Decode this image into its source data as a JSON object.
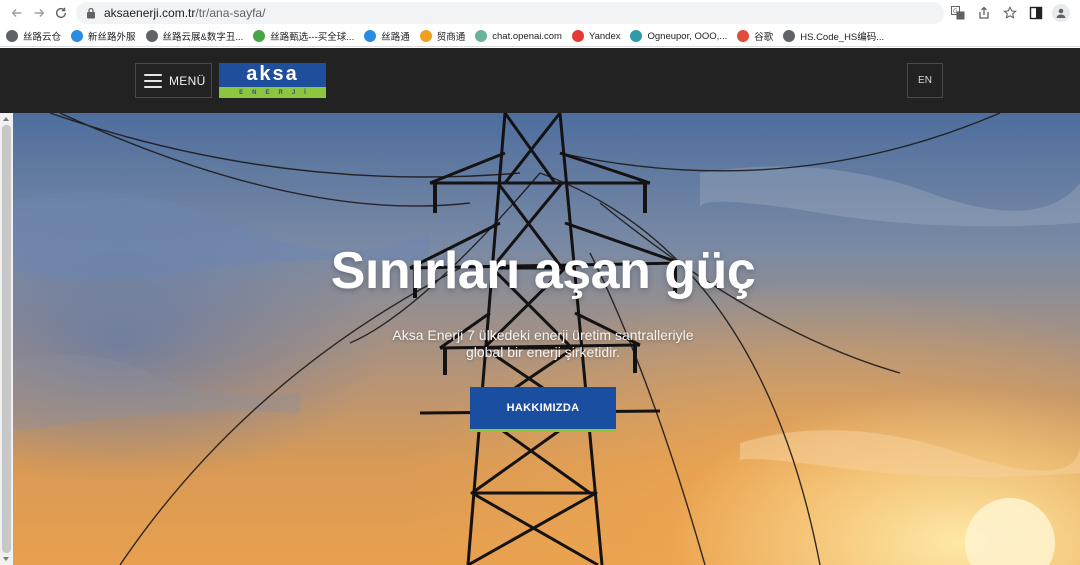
{
  "browser": {
    "url_host": "aksaenerji.com.tr",
    "url_path": "/tr/ana-sayfa/",
    "bookmarks": [
      {
        "label": "丝路云仓",
        "icon": "globe-icon",
        "color": "#5f6368"
      },
      {
        "label": "新丝路外服",
        "icon": "silk-road-icon",
        "color": "#2b8be0"
      },
      {
        "label": "丝路云展&数字丑...",
        "icon": "globe-icon",
        "color": "#5f6368"
      },
      {
        "label": "丝路甄选---买全球...",
        "icon": "leaf-icon",
        "color": "#46a546"
      },
      {
        "label": "丝路通",
        "icon": "silk-road-icon",
        "color": "#2b8be0"
      },
      {
        "label": "贸商通",
        "icon": "search-icon",
        "color": "#f0a020"
      },
      {
        "label": "chat.openai.com",
        "icon": "openai-icon",
        "color": "#6ab39c"
      },
      {
        "label": "Yandex",
        "icon": "yandex-icon",
        "color": "#e53935"
      },
      {
        "label": "Ogneupor, ООО,...",
        "icon": "bird-icon",
        "color": "#2f9aa8"
      },
      {
        "label": "谷歌",
        "icon": "g-icon",
        "color": "#e04b3a"
      },
      {
        "label": "HS.Code_HS编码...",
        "icon": "globe-icon",
        "color": "#5f6368"
      }
    ]
  },
  "header": {
    "menu_label": "MENÜ",
    "logo_word": "aksa",
    "logo_sub": "ENERJİ",
    "lang_label": "EN"
  },
  "hero": {
    "title": "Sınırları aşan güç",
    "subtitle_line1": "Aksa Enerji 7 ülkedeki enerji üretim santralleriyle",
    "subtitle_line2": "global bir enerji şirketidir.",
    "cta_label": "HAKKIMIZDA"
  },
  "colors": {
    "header_bg": "#222222",
    "brand_blue": "#1a4ea0",
    "brand_green": "#8cc63f"
  }
}
